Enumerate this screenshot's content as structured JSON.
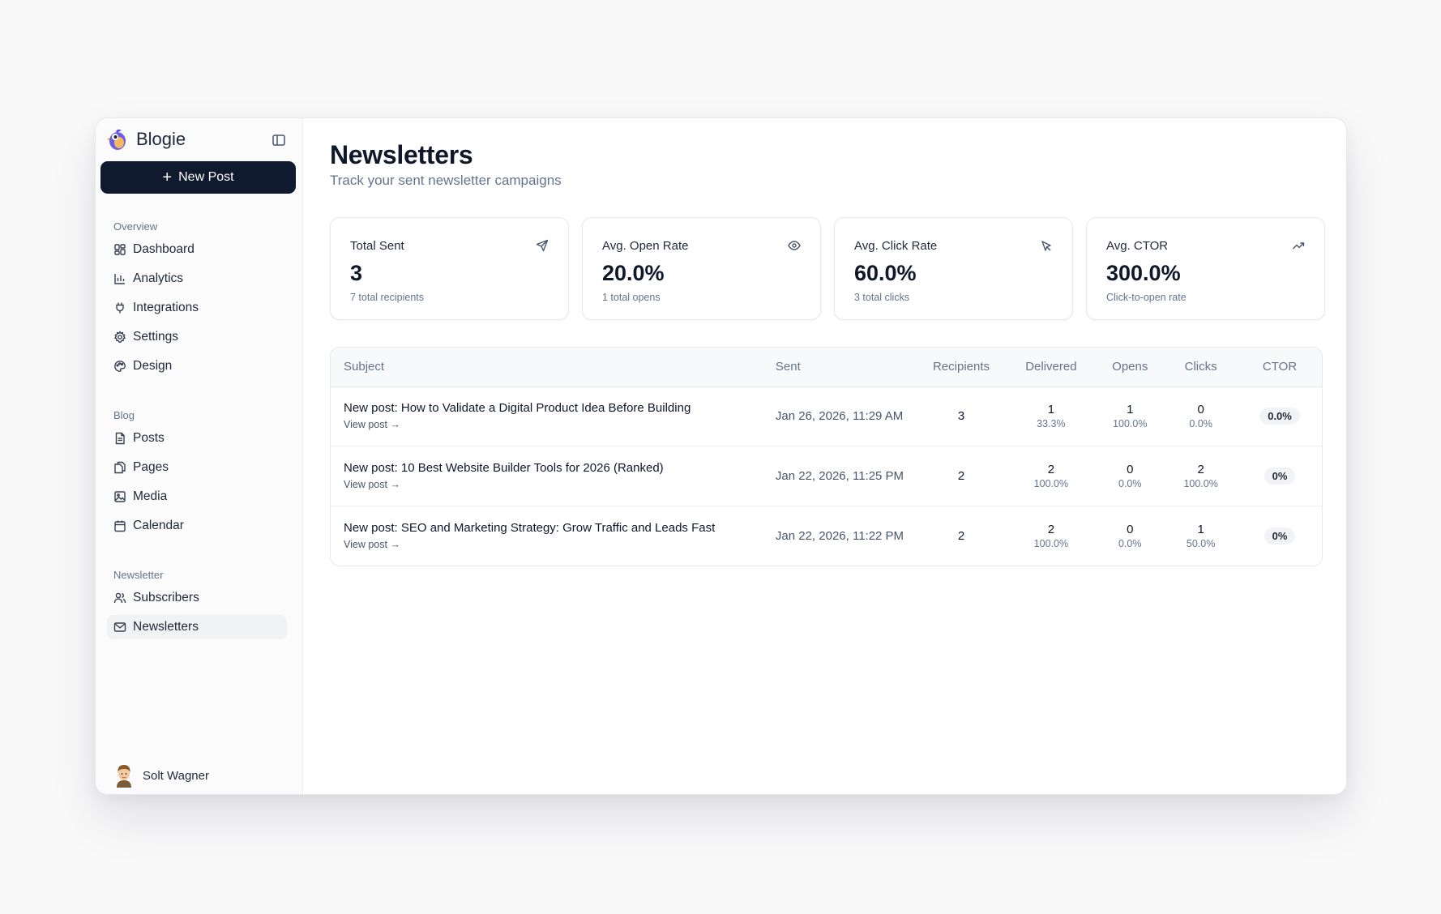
{
  "brand": {
    "name": "Blogie"
  },
  "sidebar": {
    "new_post_label": "New Post",
    "sections": [
      {
        "label": "Overview",
        "items": [
          "Dashboard",
          "Analytics",
          "Integrations",
          "Settings",
          "Design"
        ]
      },
      {
        "label": "Blog",
        "items": [
          "Posts",
          "Pages",
          "Media",
          "Calendar"
        ]
      },
      {
        "label": "Newsletter",
        "items": [
          "Subscribers",
          "Newsletters"
        ]
      }
    ],
    "active_item": "Newsletters",
    "user": {
      "name": "Solt Wagner"
    }
  },
  "page": {
    "title": "Newsletters",
    "subtitle": "Track your sent newsletter campaigns"
  },
  "stats": [
    {
      "label": "Total Sent",
      "value": "3",
      "sub": "7 total recipients",
      "icon": "send-icon"
    },
    {
      "label": "Avg. Open Rate",
      "value": "20.0%",
      "sub": "1 total opens",
      "icon": "eye-icon"
    },
    {
      "label": "Avg. Click Rate",
      "value": "60.0%",
      "sub": "3 total clicks",
      "icon": "cursor-click-icon"
    },
    {
      "label": "Avg. CTOR",
      "value": "300.0%",
      "sub": "Click-to-open rate",
      "icon": "trending-up-icon"
    }
  ],
  "table": {
    "headers": [
      "Subject",
      "Sent",
      "Recipients",
      "Delivered",
      "Opens",
      "Clicks",
      "CTOR"
    ],
    "view_post_label": "View post →",
    "rows": [
      {
        "subject": "New post: How to Validate a Digital Product Idea Before Building",
        "sent": "Jan 26, 2026, 11:29 AM",
        "recipients": "3",
        "delivered": "1",
        "delivered_pct": "33.3%",
        "opens": "1",
        "opens_pct": "100.0%",
        "clicks": "0",
        "clicks_pct": "0.0%",
        "ctor": "0.0%"
      },
      {
        "subject": "New post: 10 Best Website Builder Tools for 2026 (Ranked)",
        "sent": "Jan 22, 2026, 11:25 PM",
        "recipients": "2",
        "delivered": "2",
        "delivered_pct": "100.0%",
        "opens": "0",
        "opens_pct": "0.0%",
        "clicks": "2",
        "clicks_pct": "100.0%",
        "ctor": "0%"
      },
      {
        "subject": "New post: SEO and Marketing Strategy: Grow Traffic and Leads Fast",
        "sent": "Jan 22, 2026, 11:22 PM",
        "recipients": "2",
        "delivered": "2",
        "delivered_pct": "100.0%",
        "opens": "0",
        "opens_pct": "0.0%",
        "clicks": "1",
        "clicks_pct": "50.0%",
        "ctor": "0%"
      }
    ]
  }
}
